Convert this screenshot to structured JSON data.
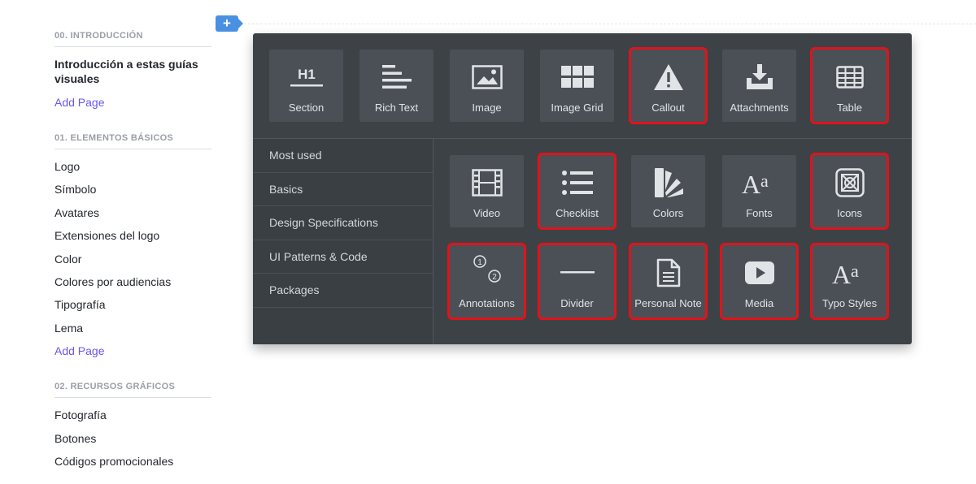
{
  "sidebar": {
    "sections": [
      {
        "heading": "00. INTRODUCCIÓN",
        "items": [
          "Introducción a estas guías visuales"
        ],
        "add_label": "Add Page"
      },
      {
        "heading": "01. ELEMENTOS BÁSICOS",
        "items": [
          "Logo",
          "Símbolo",
          "Avatares",
          "Extensiones del logo",
          "Color",
          "Colores por audiencias",
          "Tipografía",
          "Lema"
        ],
        "add_label": "Add Page"
      },
      {
        "heading": "02. RECURSOS GRÁFICOS",
        "items": [
          "Fotografía",
          "Botones",
          "Códigos promocionales"
        ]
      }
    ]
  },
  "plus_label": "+",
  "panel": {
    "top_blocks": [
      {
        "label": "Section",
        "icon": "h1-section-icon",
        "highlighted": false
      },
      {
        "label": "Rich Text",
        "icon": "rich-text-icon",
        "highlighted": false
      },
      {
        "label": "Image",
        "icon": "image-icon",
        "highlighted": false
      },
      {
        "label": "Image Grid",
        "icon": "image-grid-icon",
        "highlighted": false
      },
      {
        "label": "Callout",
        "icon": "warning-triangle-icon",
        "highlighted": true
      },
      {
        "label": "Attachments",
        "icon": "download-tray-icon",
        "highlighted": false
      },
      {
        "label": "Table",
        "icon": "table-icon",
        "highlighted": true
      }
    ],
    "categories": [
      "Most used",
      "Basics",
      "Design Specifications",
      "UI Patterns & Code",
      "Packages"
    ],
    "grid_blocks": [
      {
        "label": "Video",
        "icon": "film-icon",
        "highlighted": false
      },
      {
        "label": "Checklist",
        "icon": "checklist-icon",
        "highlighted": true
      },
      {
        "label": "Colors",
        "icon": "color-swatch-icon",
        "highlighted": false
      },
      {
        "label": "Fonts",
        "icon": "font-aa-icon",
        "highlighted": false
      },
      {
        "label": "Icons",
        "icon": "icon-box-icon",
        "highlighted": true
      },
      {
        "label": "Annotations",
        "icon": "annotations-icon",
        "highlighted": true
      },
      {
        "label": "Divider",
        "icon": "divider-line-icon",
        "highlighted": true
      },
      {
        "label": "Personal Note",
        "icon": "document-note-icon",
        "highlighted": true
      },
      {
        "label": "Media",
        "icon": "play-media-icon",
        "highlighted": true
      },
      {
        "label": "Typo Styles",
        "icon": "typo-aa-icon",
        "highlighted": true
      }
    ],
    "colors": {
      "panel_bg": "#3d4247",
      "tile_bg": "#4a5056",
      "highlight": "#e0131b",
      "accent": "#4a90e2",
      "link": "#6857f2"
    }
  }
}
